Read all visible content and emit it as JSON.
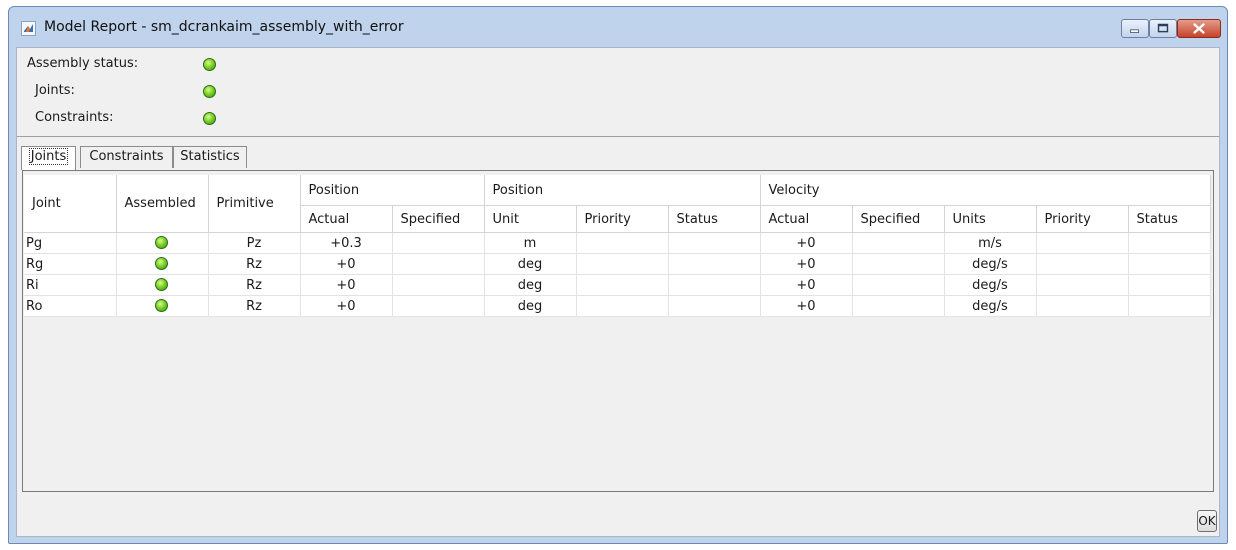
{
  "window": {
    "title": "Model Report - sm_dcrankaim_assembly_with_error"
  },
  "status": {
    "rows": [
      {
        "label": "Assembly status:",
        "state": "ok"
      },
      {
        "label": "Joints:",
        "state": "ok"
      },
      {
        "label": "Constraints:",
        "state": "ok"
      }
    ]
  },
  "tabs": [
    "Joints",
    "Constraints",
    "Statistics"
  ],
  "active_tab": "Joints",
  "table": {
    "group_headers": {
      "position_actual": "Position",
      "position_unit": "Position",
      "velocity": "Velocity"
    },
    "headers": {
      "joint": "Joint",
      "assembled": "Assembled",
      "primitive": "Primitive",
      "actual": "Actual",
      "specified": "Specified",
      "unit": "Unit",
      "priority": "Priority",
      "status": "Status",
      "v_actual": "Actual",
      "v_specified": "Specified",
      "v_units": "Units",
      "v_priority": "Priority",
      "v_status": "Status"
    },
    "rows": [
      {
        "joint": "Pg",
        "assembled": "ok",
        "primitive": "Pz",
        "pos_actual": "+0.3",
        "pos_unit": "m",
        "vel_actual": "+0",
        "vel_units": "m/s"
      },
      {
        "joint": "Rg",
        "assembled": "ok",
        "primitive": "Rz",
        "pos_actual": "+0",
        "pos_unit": "deg",
        "vel_actual": "+0",
        "vel_units": "deg/s"
      },
      {
        "joint": "Ri",
        "assembled": "ok",
        "primitive": "Rz",
        "pos_actual": "+0",
        "pos_unit": "deg",
        "vel_actual": "+0",
        "vel_units": "deg/s"
      },
      {
        "joint": "Ro",
        "assembled": "ok",
        "primitive": "Rz",
        "pos_actual": "+0",
        "pos_unit": "deg",
        "vel_actual": "+0",
        "vel_units": "deg/s"
      }
    ]
  },
  "buttons": {
    "ok": "OK"
  },
  "colors": {
    "status_ok": "#7ed321",
    "titlebar": "#bfd3ec",
    "close_button": "#c6432a"
  }
}
